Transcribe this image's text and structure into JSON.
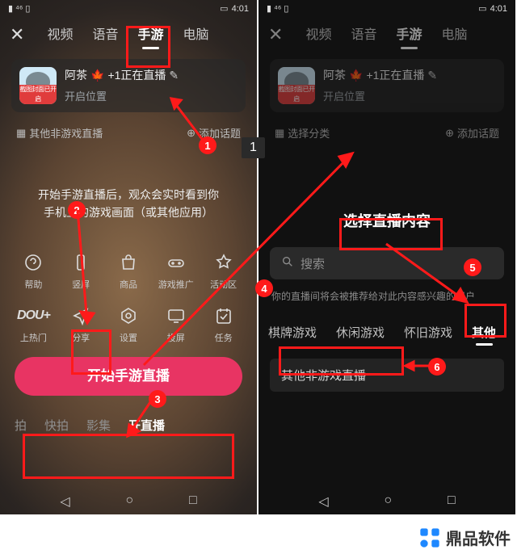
{
  "status": {
    "left": "HD ⁴⁶ �signal",
    "time": "4:01"
  },
  "tabs": {
    "close": "✕",
    "items": [
      "视频",
      "语音",
      "手游",
      "电脑"
    ],
    "activeIndex": 2
  },
  "user": {
    "avatarCaption": "截图封面已开启",
    "name": "阿茶",
    "badge": "🍁",
    "suffix": "+1正在直播",
    "edit": "✎",
    "sub": "开启位置"
  },
  "chipsA": {
    "left": "其他非游戏直播",
    "right": "添加话题"
  },
  "chipsB": {
    "left": "选择分类",
    "right": "添加话题"
  },
  "desc": "开始手游直播后，观众会实时看到你\n手机上的游戏画面（或其他应用）",
  "row1": [
    {
      "label": "帮助",
      "name": "help"
    },
    {
      "label": "竖屏",
      "name": "orientation"
    },
    {
      "label": "商品",
      "name": "goods"
    },
    {
      "label": "游戏推广",
      "name": "promo"
    },
    {
      "label": "活动区",
      "name": "activity"
    }
  ],
  "row2": [
    {
      "label": "上热门",
      "name": "dou"
    },
    {
      "label": "分享",
      "name": "share"
    },
    {
      "label": "设置",
      "name": "settings"
    },
    {
      "label": "投屏",
      "name": "cast"
    },
    {
      "label": "任务",
      "name": "tasks"
    }
  ],
  "bigbtn": "开始手游直播",
  "bnav": [
    "拍",
    "快拍",
    "影集",
    "开直播"
  ],
  "titleB": "选择直播内容",
  "search": {
    "placeholder": "搜索"
  },
  "hintB": "你的直播间将会被推荐给对此内容感兴趣的用户",
  "cats": [
    "棋牌游戏",
    "休闲游戏",
    "怀旧游戏",
    "其他"
  ],
  "otherGame": "其他非游戏直播",
  "badges": [
    "1",
    "2",
    "3",
    "4",
    "5",
    "6"
  ],
  "stepno": "1",
  "watermark": "鼎品软件"
}
